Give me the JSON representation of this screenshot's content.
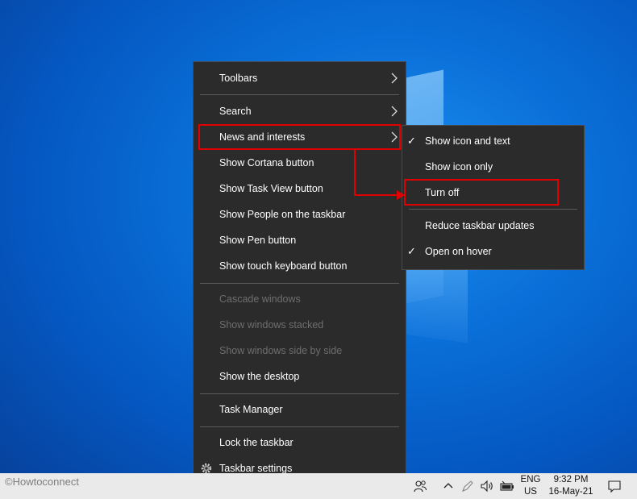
{
  "context_menu": {
    "items": [
      {
        "label": "Toolbars",
        "submenu": true,
        "enabled": true
      },
      {
        "label": "Search",
        "submenu": true,
        "enabled": true
      },
      {
        "label": "News and interests",
        "submenu": true,
        "enabled": true,
        "highlighted": true
      },
      {
        "label": "Show Cortana button",
        "enabled": true
      },
      {
        "label": "Show Task View button",
        "enabled": true
      },
      {
        "label": "Show People on the taskbar",
        "enabled": true
      },
      {
        "label": "Show Pen button",
        "enabled": true
      },
      {
        "label": "Show touch keyboard button",
        "enabled": true
      },
      {
        "label": "Cascade windows",
        "enabled": false
      },
      {
        "label": "Show windows stacked",
        "enabled": false
      },
      {
        "label": "Show windows side by side",
        "enabled": false
      },
      {
        "label": "Show the desktop",
        "enabled": true
      },
      {
        "label": "Task Manager",
        "enabled": true
      },
      {
        "label": "Lock the taskbar",
        "enabled": true
      },
      {
        "label": "Taskbar settings",
        "icon": "gear-icon",
        "enabled": true
      }
    ]
  },
  "news_submenu": {
    "items": [
      {
        "label": "Show icon and text",
        "checked": true
      },
      {
        "label": "Show icon only",
        "checked": false
      },
      {
        "label": "Turn off",
        "checked": false,
        "highlighted": true
      },
      {
        "label": "Reduce taskbar updates",
        "checked": false
      },
      {
        "label": "Open on hover",
        "checked": true
      }
    ]
  },
  "taskbar": {
    "watermark": "©Howtoconnect",
    "language": "ENG",
    "region": "US",
    "time": "9:32 PM",
    "date": "16-May-21",
    "tray_icons": [
      "people-icon",
      "chevron-up-icon",
      "pen-icon",
      "volume-icon",
      "battery-icon",
      "notification-icon"
    ]
  },
  "colors": {
    "menu_bg": "#2b2b2b",
    "highlight_border": "#e00000",
    "disabled_text": "#6e6e6e",
    "desktop_blue": "#0a6fd8"
  }
}
